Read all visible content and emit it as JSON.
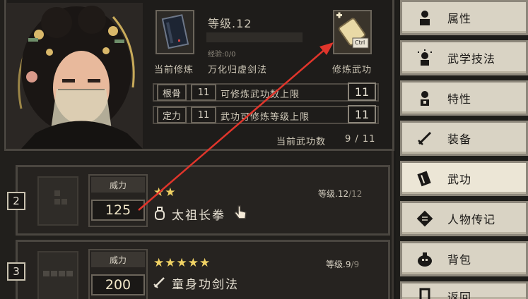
{
  "header": {
    "level_label": "等级",
    "level_value": ".12",
    "exp_label": "经验",
    "exp_value": ":0/0",
    "current_cultivation": "当前修炼",
    "current_skill": "万化归虚剑法",
    "cultivate_skill": "修炼武功",
    "ctrl_hint": "Ctrl"
  },
  "stats": [
    {
      "label": "根骨",
      "value": "11",
      "desc": "可修炼武功数上限",
      "result": "11"
    },
    {
      "label": "定力",
      "value": "11",
      "desc": "武功可修炼等级上限",
      "result": "11"
    }
  ],
  "skill_count": {
    "label": "当前武功数",
    "value": "9 / 11"
  },
  "entries": [
    {
      "index": "2",
      "power_label": "威力",
      "power": "125",
      "stars": "★★",
      "level_label": "等级",
      "level": ".12",
      "level_max": "/12",
      "name": "太祖长拳",
      "type_icon": "fist-icon"
    },
    {
      "index": "3",
      "power_label": "威力",
      "power": "200",
      "stars": "★★★★★",
      "level_label": "等级",
      "level": ".9",
      "level_max": "/9",
      "name": "童身功剑法",
      "type_icon": "sword-icon"
    }
  ],
  "menu": [
    {
      "label": "属性",
      "icon": "person-icon"
    },
    {
      "label": "武学技法",
      "icon": "aura-person-icon"
    },
    {
      "label": "特性",
      "icon": "trait-icon"
    },
    {
      "label": "装备",
      "icon": "sword-icon"
    },
    {
      "label": "武功",
      "icon": "book-icon"
    },
    {
      "label": "人物传记",
      "icon": "scroll-icon"
    },
    {
      "label": "背包",
      "icon": "bag-icon"
    },
    {
      "label": "返回",
      "icon": "return-icon"
    }
  ],
  "colors": {
    "accent_star": "#f0d264",
    "arrow": "#e0352b",
    "menu_bg": "#d9d3c4"
  }
}
